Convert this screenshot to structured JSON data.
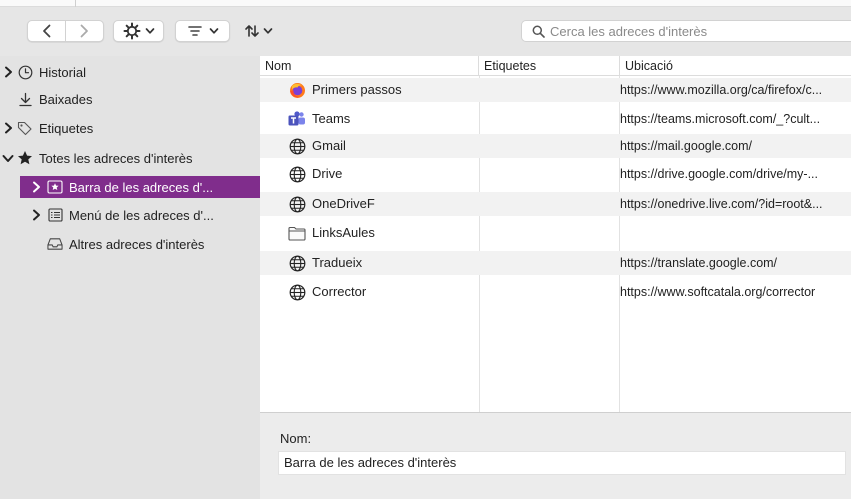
{
  "toolbar": {
    "search_placeholder": "Cerca les adreces d'interès"
  },
  "sidebar": {
    "items": [
      {
        "label": "Historial"
      },
      {
        "label": "Baixades"
      },
      {
        "label": "Etiquetes"
      },
      {
        "label": "Totes les adreces d'interès"
      },
      {
        "label": "Barra de les adreces d'..."
      },
      {
        "label": "Menú de les adreces d'..."
      },
      {
        "label": "Altres adreces d'interès"
      }
    ]
  },
  "table": {
    "columns": [
      "Nom",
      "Etiquetes",
      "Ubicació"
    ],
    "rows": [
      {
        "name": "Primers passos",
        "tags": "",
        "location": "https://www.mozilla.org/ca/firefox/c...",
        "icon": "firefox-icon"
      },
      {
        "name": "Teams",
        "tags": "",
        "location": "https://teams.microsoft.com/_?cult...",
        "icon": "teams-icon"
      },
      {
        "name": "Gmail",
        "tags": "",
        "location": "https://mail.google.com/",
        "icon": "globe-icon"
      },
      {
        "name": "Drive",
        "tags": "",
        "location": "https://drive.google.com/drive/my-...",
        "icon": "globe-icon"
      },
      {
        "name": "OneDriveF",
        "tags": "",
        "location": "https://onedrive.live.com/?id=root&...",
        "icon": "globe-icon"
      },
      {
        "name": "LinksAules",
        "tags": "",
        "location": "",
        "icon": "folder-icon"
      },
      {
        "name": "Tradueix",
        "tags": "",
        "location": "https://translate.google.com/",
        "icon": "globe-icon"
      },
      {
        "name": "Corrector",
        "tags": "",
        "location": "https://www.softcatala.org/corrector",
        "icon": "globe-icon"
      }
    ]
  },
  "details": {
    "name_label": "Nom:",
    "name_value": "Barra de les adreces d'interès"
  },
  "colors": {
    "selection": "#802d8c",
    "sidebar_bg": "#e3e3e3",
    "row_alt": "#f2f2f2"
  }
}
